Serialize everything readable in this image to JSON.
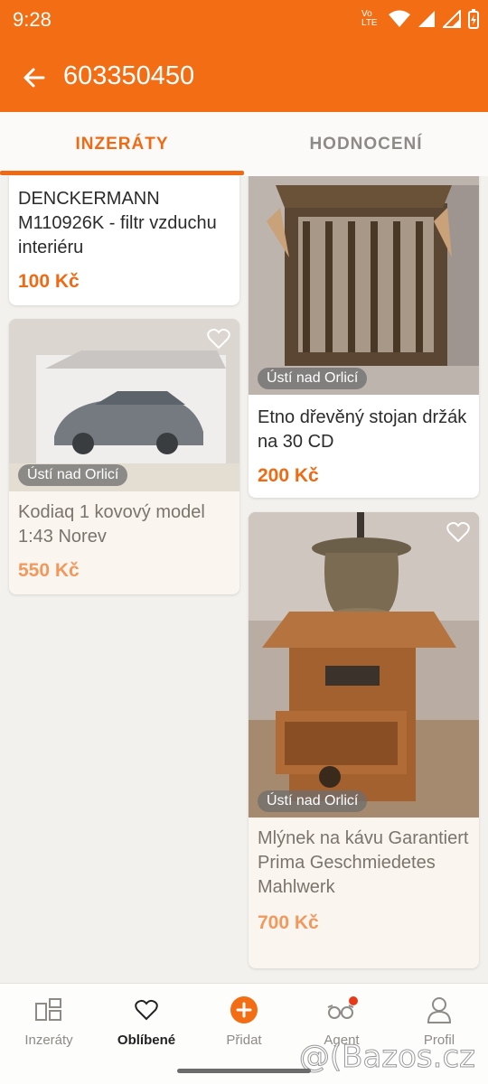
{
  "status_bar": {
    "time": "9:28",
    "network": "Vo LTE"
  },
  "header": {
    "title": "603350450"
  },
  "tabs": [
    {
      "label": "INZERÁTY",
      "active": true
    },
    {
      "label": "HODNOCENÍ",
      "active": false
    }
  ],
  "listings": [
    {
      "title": "DENCKERMANN M110926K - filtr vzduchu interiéru",
      "price": "100 Kč"
    },
    {
      "title": "Kodiaq 1 kovový model 1:43 Norev",
      "price": "550 Kč",
      "location": "Ústí nad Orlicí"
    },
    {
      "title": "Etno dřevěný stojan držák na 30 CD",
      "price": "200 Kč",
      "location": "Ústí nad Orlicí"
    },
    {
      "title": "Mlýnek na kávu Garantiert Prima Geschmiedetes Mahlwerk",
      "price": "700 Kč",
      "location": "Ústí nad Orlicí"
    }
  ],
  "bottom_nav": [
    {
      "label": "Inzeráty",
      "icon": "listings-icon"
    },
    {
      "label": "Oblíbené",
      "icon": "heart-icon",
      "active": true
    },
    {
      "label": "Přidat",
      "icon": "add-icon"
    },
    {
      "label": "Agent",
      "icon": "agent-glasses-icon"
    },
    {
      "label": "Profil",
      "icon": "profile-icon"
    }
  ],
  "watermark": "@(Bazos.cz",
  "colors": {
    "accent": "#f26d14",
    "price": "#ef6a14"
  }
}
